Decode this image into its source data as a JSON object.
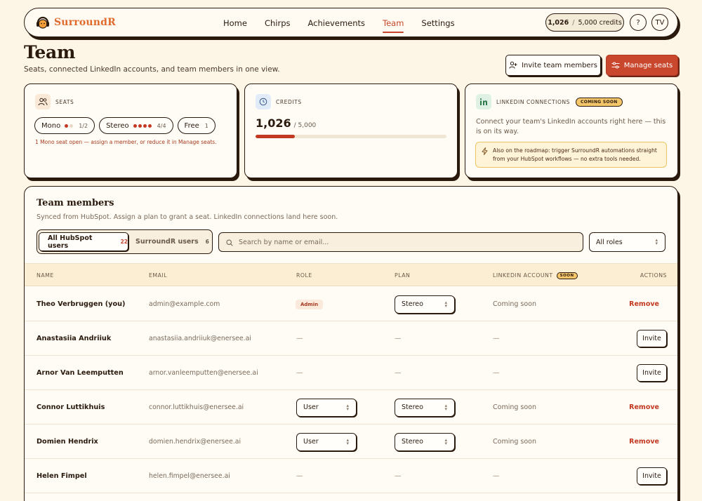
{
  "brand": {
    "name": "SurroundR",
    "accent": "#e06a2c",
    "primary": "#c9472c"
  },
  "nav": {
    "links": [
      {
        "label": "Home"
      },
      {
        "label": "Chirps"
      },
      {
        "label": "Achievements"
      },
      {
        "label": "Team",
        "active": true
      },
      {
        "label": "Settings"
      }
    ],
    "credits_used": "1,026",
    "credits_sep": "/",
    "credits_total": "5,000 credits",
    "help": "?",
    "avatar": "TV"
  },
  "header": {
    "title": "Team",
    "subtitle": "Seats, connected LinkedIn accounts, and team members in one view.",
    "invite_label": "Invite team members",
    "manage_label": "Manage seats"
  },
  "seats": {
    "label": "SEATS",
    "chips": [
      {
        "name": "Mono",
        "count": "1/2",
        "filled": 1,
        "total": 2
      },
      {
        "name": "Stereo",
        "count": "4/4",
        "filled": 4,
        "total": 4
      },
      {
        "name": "Free",
        "count": "1"
      }
    ],
    "note": "1 Mono seat open — assign a member, or reduce it in Manage seats."
  },
  "credits": {
    "label": "CREDITS",
    "used": "1,026",
    "total": "/ 5,000",
    "fraction": 0.2052
  },
  "linkedin": {
    "label": "LINKEDIN CONNECTIONS",
    "badge": "COMING SOON",
    "text": "Connect your team's LinkedIn accounts right here — this is on its way.",
    "roadmap": "Also on the roadmap: trigger SurroundR automations straight from your HubSpot workflows — no extra tools needed."
  },
  "team": {
    "title": "Team members",
    "subtitle": "Synced from HubSpot. Assign a plan to grant a seat. LinkedIn connections land here soon.",
    "tabs": [
      {
        "label": "All HubSpot users",
        "count": "22"
      },
      {
        "label": "SurroundR users",
        "count": "6"
      }
    ],
    "search_placeholder": "Search by name or email...",
    "roles_value": "All roles",
    "columns": {
      "name": "NAME",
      "email": "EMAIL",
      "role": "ROLE",
      "plan": "PLAN",
      "linkedin": "LINKEDIN ACCOUNT",
      "linkedin_badge": "SOON",
      "actions": "ACTIONS"
    },
    "rows": [
      {
        "name": "Theo Verbruggen (you)",
        "email": "admin@example.com",
        "role": "Admin",
        "role_type": "badge",
        "plan": "Stereo",
        "linkedin": "Coming soon",
        "action": "Remove"
      },
      {
        "name": "Anastasiia Andriiuk",
        "email": "anastasiia.andriiuk@enersee.ai",
        "role": "—",
        "role_type": "dash",
        "plan": "—",
        "linkedin": "—",
        "action": "Invite"
      },
      {
        "name": "Arnor Van Leemputten",
        "email": "arnor.vanleemputten@enersee.ai",
        "role": "—",
        "role_type": "dash",
        "plan": "—",
        "linkedin": "—",
        "action": "Invite"
      },
      {
        "name": "Connor Luttikhuis",
        "email": "connor.luttikhuis@enersee.ai",
        "role": "User",
        "role_type": "select",
        "plan": "Stereo",
        "linkedin": "Coming soon",
        "action": "Remove"
      },
      {
        "name": "Domien Hendrix",
        "email": "domien.hendrix@enersee.ai",
        "role": "User",
        "role_type": "select",
        "plan": "Stereo",
        "linkedin": "Coming soon",
        "action": "Remove"
      },
      {
        "name": "Helen Fimpel",
        "email": "helen.fimpel@enersee.ai",
        "role": "—",
        "role_type": "dash",
        "plan": "—",
        "linkedin": "—",
        "action": "Invite"
      }
    ]
  }
}
